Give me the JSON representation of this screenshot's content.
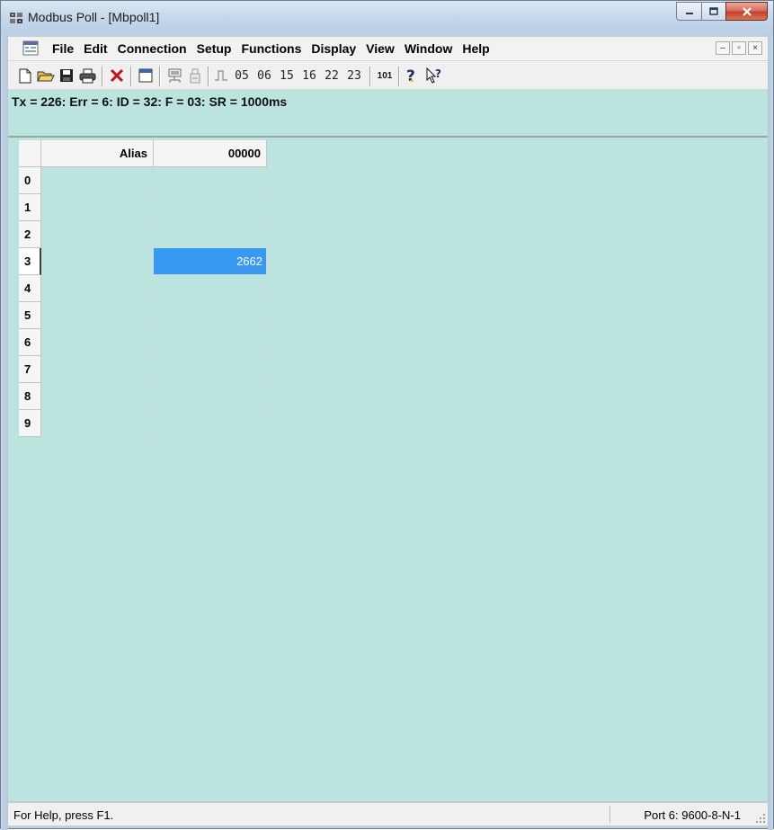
{
  "window": {
    "title": "Modbus Poll - [Mbpoll1]"
  },
  "menu": {
    "items": [
      "File",
      "Edit",
      "Connection",
      "Setup",
      "Functions",
      "Display",
      "View",
      "Window",
      "Help"
    ]
  },
  "toolbar": {
    "function_codes": [
      "05",
      "06",
      "15",
      "16",
      "22",
      "23"
    ],
    "btn_101": "101"
  },
  "status_line": "Tx = 226: Err = 6: ID = 32: F = 03: SR = 1000ms",
  "grid": {
    "headers": [
      "Alias",
      "00000"
    ],
    "rows": [
      {
        "index": "0",
        "alias": "",
        "value": ""
      },
      {
        "index": "1",
        "alias": "",
        "value": ""
      },
      {
        "index": "2",
        "alias": "",
        "value": ""
      },
      {
        "index": "3",
        "alias": "",
        "value": "2662"
      },
      {
        "index": "4",
        "alias": "",
        "value": ""
      },
      {
        "index": "5",
        "alias": "",
        "value": ""
      },
      {
        "index": "6",
        "alias": "",
        "value": ""
      },
      {
        "index": "7",
        "alias": "",
        "value": ""
      },
      {
        "index": "8",
        "alias": "",
        "value": ""
      },
      {
        "index": "9",
        "alias": "",
        "value": ""
      }
    ],
    "selected_row": 3
  },
  "statusbar": {
    "help_text": "For Help, press F1.",
    "port_text": "Port 6: 9600-8-N-1"
  },
  "colors": {
    "client_bg": "#bce4df",
    "selection": "#3799f1"
  }
}
